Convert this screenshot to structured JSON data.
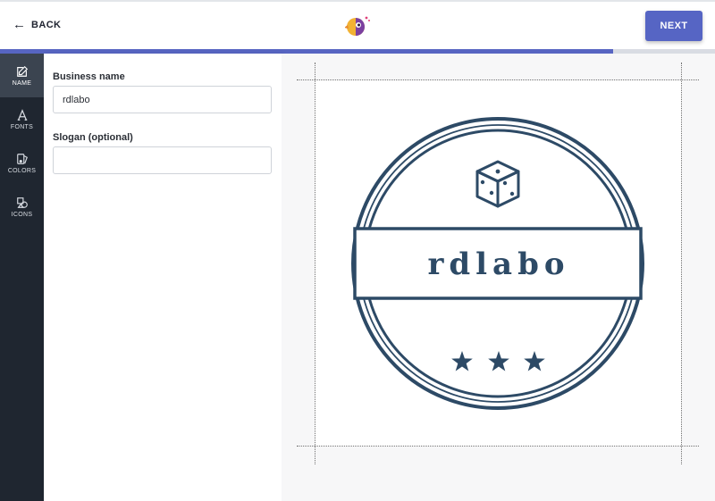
{
  "header": {
    "back_label": "BACK",
    "next_label": "NEXT",
    "logo_icon": "parrot-logo-icon"
  },
  "progress": {
    "fraction": 0.857,
    "color": "#5765c2"
  },
  "sidebar": {
    "items": [
      {
        "label": "NAME",
        "icon": "edit-icon",
        "active": true
      },
      {
        "label": "FONTS",
        "icon": "font-icon",
        "active": false
      },
      {
        "label": "COLORS",
        "icon": "palette-icon",
        "active": false
      },
      {
        "label": "ICONS",
        "icon": "shapes-icon",
        "active": false
      }
    ]
  },
  "form": {
    "business_name_label": "Business name",
    "business_name_value": "rdlabo",
    "slogan_label": "Slogan (optional)",
    "slogan_value": ""
  },
  "preview": {
    "logo_text": "rdlabo",
    "logo_color": "#2d4a66",
    "icon": "dice-icon",
    "stars": 3
  }
}
